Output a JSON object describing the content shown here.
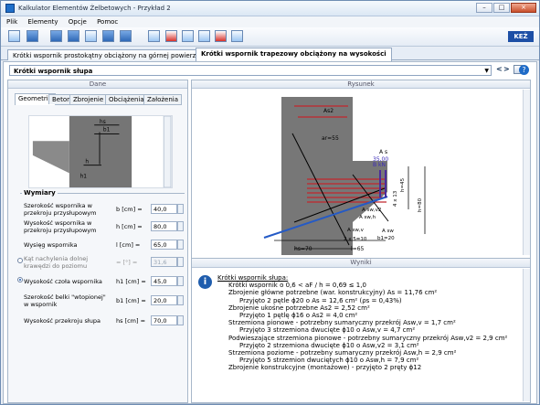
{
  "window": {
    "title": "Kalkulator Elementów Żelbetowych - Przykład 2",
    "controls": [
      "–",
      "□",
      "×"
    ]
  },
  "menu": [
    "Plik",
    "Elementy",
    "Opcje",
    "Pomoc"
  ],
  "tabs": [
    "Krótki wspornik prostokątny obciążony na górnej powierzchni",
    "Krótki wspornik trapezowy obciążony na wysokości"
  ],
  "selector": "Krótki wspornik słupa",
  "nav": {
    "prev": "<",
    "next": ">"
  },
  "panels": {
    "left": "Dane",
    "right": "Rysunek",
    "results": "Wyniki"
  },
  "subtabs": [
    "Geometria",
    "Beton",
    "Zbrojenie",
    "Obciążenia",
    "Założenia"
  ],
  "dimensions": {
    "title": "Wymiary",
    "rows": [
      {
        "label": "Szerokość wspornika w przekroju przysłupowym",
        "unit": "b [cm] =",
        "value": "40,0"
      },
      {
        "label": "Wysokość wspornika w przekroju przysłupowym",
        "unit": "h [cm] =",
        "value": "80,0"
      },
      {
        "label": "Wysięg wspornika",
        "unit": "l [cm] =",
        "value": "65,0"
      },
      {
        "label": "Kąt nachylenia dolnej krawędzi do poziomu",
        "unit": "= [°] =",
        "value": "31,6"
      },
      {
        "label": "Wysokość czoła wspornika",
        "unit": "h1 [cm] =",
        "value": "45,0"
      },
      {
        "label": "Szerokość belki \"wtopionej\" w wspornik",
        "unit": "b1 [cm] =",
        "value": "20,0"
      },
      {
        "label": "Wysokość przekroju słupa",
        "unit": "hs [cm] =",
        "value": "70,0"
      }
    ]
  },
  "drawing": {
    "labels": [
      "As2",
      "ar=55",
      "A s",
      "35,00",
      "B kN",
      "A sw,v2",
      "A sw,h",
      "A sw,v",
      "A sw",
      "hs=70",
      "l=65",
      "2 x 5=10",
      "b1=20",
      "h=45",
      "h=80",
      "4 x 13"
    ]
  },
  "results": [
    "Krótki wspornik słupa:",
    "Krótki wspornik o 0,6 < aF / h = 0,69 ≤ 1,0",
    "Zbrojenie główne potrzebne (war. konstrukcyjny) As = 11,76 cm²",
    "Przyjęto 2 pętle ϕ20 o As = 12,6 cm² (ρs = 0,43%)",
    "Zbrojenie ukośne potrzebne As2 = 2,52 cm²",
    "Przyjęto 1 pętlę ϕ16 o As2 = 4,0 cm²",
    "Strzemiona pionowe - potrzebny sumaryczny przekrój Asw,v = 1,7 cm²",
    "Przyjęto 3 strzemiona dwucięte ϕ10 o Asw,v = 4,7 cm²",
    "Podwieszające strzemiona pionowe - potrzebny sumaryczny przekrój Asw,v2 = 2,9 cm²",
    "Przyjęto 2 strzemiona dwucięte ϕ10 o Asw,v2 = 3,1 cm²",
    "Strzemiona poziome - potrzebny sumaryczny przekrój Asw,h = 2,9 cm²",
    "Przyjęto 5 strzemion dwuciętych ϕ10 o Asw,h = 7,9 cm²",
    "Zbrojenie konstrukcyjne (montażowe) - przyjęto 2 pręty ϕ12"
  ]
}
